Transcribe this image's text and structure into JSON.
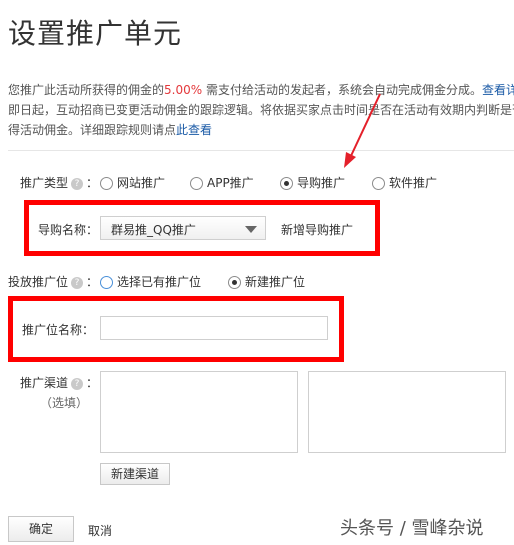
{
  "page": {
    "title": "设置推广单元"
  },
  "description": {
    "line1_prefix": "您推广此活动所获得的佣金的",
    "rate": "5.00%",
    "line1_suffix": " 需支付给活动的发起者，系统会自动完成佣金分成。",
    "line1_link": "查看详",
    "line2": "即日起，互动招商已变更活动佣金的跟踪逻辑。将依据买家点击时间是否在活动有效期内判断是否",
    "line3_prefix": "得活动佣金。详细跟踪规则请点",
    "line3_link": "此查看"
  },
  "promotion_type": {
    "label": "推广类型",
    "options": [
      {
        "label": "网站推广",
        "selected": false
      },
      {
        "label": "APP推广",
        "selected": false
      },
      {
        "label": "导购推广",
        "selected": true
      },
      {
        "label": "软件推广",
        "selected": false
      }
    ]
  },
  "guide_name": {
    "label": "导购名称：",
    "selected_value": "群易推_QQ推广",
    "add_link": "新增导购推广"
  },
  "placement": {
    "label": "投放推广位",
    "options": [
      {
        "label": "选择已有推广位",
        "selected": false
      },
      {
        "label": "新建推广位",
        "selected": true
      }
    ]
  },
  "placement_name": {
    "label": "推广位名称：",
    "value": ""
  },
  "channel": {
    "label": "推广渠道",
    "optional": "（选填）",
    "new_button": "新建渠道"
  },
  "actions": {
    "confirm": "确定",
    "cancel": "取消"
  },
  "watermark": "头条号 / 雪峰杂说",
  "colors": {
    "highlight_box": "#ff0000",
    "rate_text": "#e4393c",
    "link": "#1a5aa6"
  }
}
